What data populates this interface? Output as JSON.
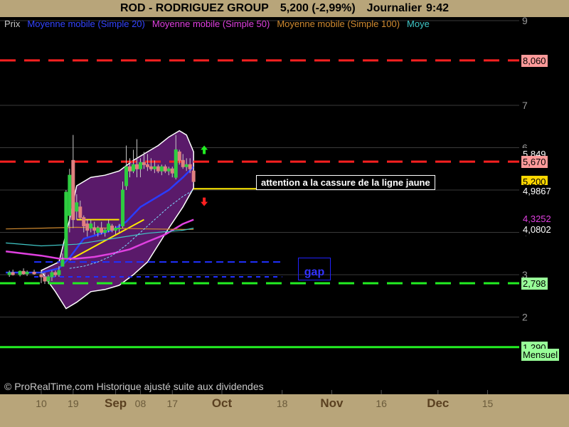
{
  "header": {
    "symbol": "ROD - RODRIGUEZ GROUP",
    "price": "5,200 (-2,99%)",
    "period": "Journalier",
    "time": "9:42"
  },
  "legend": {
    "items": [
      {
        "label": "Prix",
        "color": "#c8c8c8"
      },
      {
        "label": "Moyenne mobile (Simple 20)",
        "color": "#3344ff"
      },
      {
        "label": "Moyenne mobile (Simple 50)",
        "color": "#e040e0"
      },
      {
        "label": "Moyenne mobile (Simple 100)",
        "color": "#d08a30"
      },
      {
        "label": "Moye",
        "color": "#40c8c8"
      }
    ]
  },
  "annotations": {
    "note": "attention a la cassure de la ligne jaune",
    "gap": "gap",
    "copyright": "© ProRealTime.com Historique ajusté suite aux dividendes"
  },
  "price_tags": [
    {
      "value": 8.06,
      "text": "8,060",
      "bg": "#ff9a9a",
      "fg": "#000000"
    },
    {
      "value": 5.849,
      "text": "5,849",
      "bg": "#000000",
      "fg": "#ffffff"
    },
    {
      "value": 5.67,
      "text": "5,670",
      "bg": "#ff9a9a",
      "fg": "#000000"
    },
    {
      "value": 5.2,
      "text": "5,200",
      "bg": "#ffd700",
      "fg": "#000000"
    },
    {
      "value": 4.9867,
      "text": "4,9867",
      "bg": "#000000",
      "fg": "#ffffff"
    },
    {
      "value": 4.3252,
      "text": "4,3252",
      "bg": "#000000",
      "fg": "#e040e0"
    },
    {
      "value": 4.0802,
      "text": "4,0802",
      "bg": "#000000",
      "fg": "#ffffff"
    },
    {
      "value": 2.798,
      "text": "2,798",
      "bg": "#98ff98",
      "fg": "#000000"
    },
    {
      "value": 1.29,
      "text": "1,290",
      "bg": "#98ff98",
      "fg": "#000000"
    },
    {
      "value": 1.12,
      "text": "Mensuel",
      "bg": "#98ff98",
      "fg": "#000000"
    }
  ],
  "chart_data": {
    "type": "candlestick",
    "title": "ROD - RODRIGUEZ GROUP",
    "y_ticks": [
      2,
      3,
      4,
      5,
      6,
      7,
      9
    ],
    "ylim": [
      0.6,
      9.2
    ],
    "x_ticks": [
      {
        "label": "10",
        "bold": false,
        "day": 0
      },
      {
        "label": "19",
        "bold": false,
        "day": 9
      },
      {
        "label": "Sep",
        "bold": true,
        "day": 21
      },
      {
        "label": "08",
        "bold": false,
        "day": 28
      },
      {
        "label": "17",
        "bold": false,
        "day": 37
      },
      {
        "label": "Oct",
        "bold": true,
        "day": 51
      },
      {
        "label": "18",
        "bold": false,
        "day": 68
      },
      {
        "label": "Nov",
        "bold": true,
        "day": 82
      },
      {
        "label": "16",
        "bold": false,
        "day": 96
      },
      {
        "label": "Dec",
        "bold": true,
        "day": 112
      },
      {
        "label": "15",
        "bold": false,
        "day": 126
      }
    ],
    "horizontal_levels": [
      {
        "value": 8.06,
        "color": "#ff2020",
        "dash": "dashed"
      },
      {
        "value": 5.67,
        "color": "#ff2020",
        "dash": "dashed"
      },
      {
        "value": 2.798,
        "color": "#22ee22",
        "dash": "dashed"
      },
      {
        "value": 1.29,
        "color": "#22ee22",
        "dash": "solid"
      }
    ],
    "candles": [
      {
        "day": -9,
        "o": 3.0,
        "h": 3.1,
        "l": 2.95,
        "c": 3.05
      },
      {
        "day": -8,
        "o": 3.05,
        "h": 3.12,
        "l": 2.98,
        "c": 3.0
      },
      {
        "day": -6,
        "o": 3.0,
        "h": 3.1,
        "l": 2.96,
        "c": 3.08
      },
      {
        "day": -5,
        "o": 3.08,
        "h": 3.15,
        "l": 3.0,
        "c": 3.02
      },
      {
        "day": -4,
        "o": 3.02,
        "h": 3.1,
        "l": 2.97,
        "c": 3.06
      },
      {
        "day": -2,
        "o": 3.06,
        "h": 3.12,
        "l": 3.0,
        "c": 3.02
      },
      {
        "day": 0,
        "o": 3.0,
        "h": 3.1,
        "l": 2.8,
        "c": 2.95
      },
      {
        "day": 1,
        "o": 2.95,
        "h": 3.05,
        "l": 2.78,
        "c": 2.85
      },
      {
        "day": 2,
        "o": 2.85,
        "h": 3.0,
        "l": 2.78,
        "c": 2.95
      },
      {
        "day": 3,
        "o": 2.95,
        "h": 3.1,
        "l": 2.85,
        "c": 3.05
      },
      {
        "day": 4,
        "o": 3.05,
        "h": 3.1,
        "l": 2.95,
        "c": 3.0
      },
      {
        "day": 5,
        "o": 3.0,
        "h": 3.2,
        "l": 2.95,
        "c": 3.1
      },
      {
        "day": 6,
        "o": 3.2,
        "h": 3.5,
        "l": 3.2,
        "c": 3.35
      },
      {
        "day": 7,
        "o": 3.4,
        "h": 5.0,
        "l": 3.4,
        "c": 4.95
      },
      {
        "day": 8,
        "o": 4.4,
        "h": 5.5,
        "l": 4.0,
        "c": 5.35
      },
      {
        "day": 9,
        "o": 5.7,
        "h": 6.3,
        "l": 4.1,
        "c": 4.3
      },
      {
        "day": 10,
        "o": 4.5,
        "h": 4.9,
        "l": 4.3,
        "c": 4.7
      },
      {
        "day": 11,
        "o": 4.6,
        "h": 4.75,
        "l": 4.3,
        "c": 4.35
      },
      {
        "day": 12,
        "o": 4.35,
        "h": 4.4,
        "l": 4.0,
        "c": 4.15
      },
      {
        "day": 13,
        "o": 4.2,
        "h": 4.3,
        "l": 3.9,
        "c": 4.05
      },
      {
        "day": 14,
        "o": 4.1,
        "h": 4.3,
        "l": 4.0,
        "c": 4.2
      },
      {
        "day": 15,
        "o": 4.1,
        "h": 4.25,
        "l": 3.95,
        "c": 4.05
      },
      {
        "day": 16,
        "o": 4.0,
        "h": 4.15,
        "l": 3.9,
        "c": 4.1
      },
      {
        "day": 17,
        "o": 4.1,
        "h": 4.25,
        "l": 3.95,
        "c": 4.0
      },
      {
        "day": 18,
        "o": 4.0,
        "h": 4.1,
        "l": 3.9,
        "c": 4.05
      },
      {
        "day": 19,
        "o": 4.05,
        "h": 4.3,
        "l": 4.0,
        "c": 4.2
      },
      {
        "day": 20,
        "o": 4.15,
        "h": 4.2,
        "l": 4.0,
        "c": 4.05
      },
      {
        "day": 21,
        "o": 4.05,
        "h": 4.15,
        "l": 3.95,
        "c": 4.1
      },
      {
        "day": 22,
        "o": 4.1,
        "h": 4.2,
        "l": 4.0,
        "c": 4.1
      },
      {
        "day": 23,
        "o": 4.15,
        "h": 5.2,
        "l": 4.1,
        "c": 5.0
      },
      {
        "day": 24,
        "o": 5.1,
        "h": 6.05,
        "l": 5.0,
        "c": 5.55
      },
      {
        "day": 25,
        "o": 5.55,
        "h": 5.75,
        "l": 5.3,
        "c": 5.45
      },
      {
        "day": 26,
        "o": 5.45,
        "h": 5.95,
        "l": 5.4,
        "c": 5.6
      },
      {
        "day": 27,
        "o": 5.6,
        "h": 6.2,
        "l": 5.3,
        "c": 5.5
      },
      {
        "day": 28,
        "o": 5.5,
        "h": 5.75,
        "l": 5.3,
        "c": 5.65
      },
      {
        "day": 29,
        "o": 5.65,
        "h": 5.9,
        "l": 5.5,
        "c": 5.6
      },
      {
        "day": 30,
        "o": 5.6,
        "h": 5.85,
        "l": 5.45,
        "c": 5.55
      },
      {
        "day": 31,
        "o": 5.55,
        "h": 5.75,
        "l": 5.45,
        "c": 5.5
      },
      {
        "day": 32,
        "o": 5.5,
        "h": 5.7,
        "l": 5.4,
        "c": 5.55
      },
      {
        "day": 33,
        "o": 5.55,
        "h": 5.6,
        "l": 5.4,
        "c": 5.45
      },
      {
        "day": 34,
        "o": 5.45,
        "h": 5.6,
        "l": 5.35,
        "c": 5.55
      },
      {
        "day": 35,
        "o": 5.55,
        "h": 5.6,
        "l": 5.4,
        "c": 5.45
      },
      {
        "day": 36,
        "o": 5.45,
        "h": 5.55,
        "l": 5.35,
        "c": 5.5
      },
      {
        "day": 37,
        "o": 5.5,
        "h": 5.55,
        "l": 5.3,
        "c": 5.4
      },
      {
        "day": 38,
        "o": 5.3,
        "h": 6.3,
        "l": 5.25,
        "c": 5.95
      },
      {
        "day": 39,
        "o": 5.9,
        "h": 5.95,
        "l": 5.6,
        "c": 5.7
      },
      {
        "day": 40,
        "o": 5.7,
        "h": 5.85,
        "l": 5.5,
        "c": 5.55
      },
      {
        "day": 41,
        "o": 5.55,
        "h": 5.75,
        "l": 5.45,
        "c": 5.6
      },
      {
        "day": 42,
        "o": 5.6,
        "h": 5.75,
        "l": 5.4,
        "c": 5.5
      },
      {
        "day": 43,
        "o": 5.45,
        "h": 5.55,
        "l": 5.15,
        "c": 5.2
      }
    ],
    "series": [
      {
        "name": "Moyenne mobile (Simple 20)",
        "color": "#2a3cff",
        "width": 2.5,
        "x": [
          -10,
          0,
          5,
          8,
          12,
          16,
          20,
          24,
          28,
          32,
          36,
          40,
          43
        ],
        "y": [
          3.05,
          3.05,
          3.15,
          3.4,
          3.85,
          3.95,
          4.05,
          4.25,
          4.6,
          4.8,
          5.0,
          5.3,
          5.55
        ]
      },
      {
        "name": "Moyenne mobile (Simple 50)",
        "color": "#e040e0",
        "width": 2.5,
        "x": [
          -10,
          0,
          5,
          10,
          15,
          20,
          25,
          30,
          35,
          40,
          43
        ],
        "y": [
          3.55,
          3.45,
          3.38,
          3.38,
          3.42,
          3.5,
          3.6,
          3.78,
          3.95,
          4.2,
          4.3
        ],
        "dashed_tail_from": 8
      },
      {
        "name": "Moyenne mobile (Simple 100)",
        "color": "#d08a30",
        "width": 1.2,
        "x": [
          -10,
          0,
          10,
          20,
          30,
          40,
          43
        ],
        "y": [
          4.08,
          4.1,
          4.12,
          4.1,
          4.08,
          4.07,
          4.07
        ]
      },
      {
        "name": "Moye",
        "color": "#40c8c8",
        "width": 1.2,
        "x": [
          -10,
          0,
          10,
          20,
          30,
          40,
          43
        ],
        "y": [
          3.75,
          3.68,
          3.72,
          3.85,
          3.98,
          4.05,
          4.1
        ]
      },
      {
        "name": "Moye",
        "color": "#7fd8ff",
        "width": 1,
        "dash": "3,2",
        "x": [
          8,
          12,
          16,
          20,
          24,
          28,
          32,
          36,
          40,
          43
        ],
        "y": [
          3.15,
          3.2,
          3.3,
          3.45,
          3.7,
          4.0,
          4.3,
          4.6,
          4.85,
          5.0
        ]
      }
    ],
    "bollinger": {
      "upper_x": [
        0,
        5,
        8,
        10,
        14,
        18,
        22,
        26,
        30,
        33,
        36,
        39,
        41,
        43
      ],
      "upper_y": [
        3.1,
        3.3,
        4.3,
        5.1,
        5.3,
        5.35,
        5.45,
        5.7,
        5.9,
        6.05,
        6.25,
        6.4,
        6.3,
        5.9
      ],
      "lower_x": [
        43,
        40,
        36,
        33,
        30,
        26,
        22,
        18,
        14,
        10,
        7,
        4,
        1,
        0
      ],
      "lower_y": [
        5.05,
        4.6,
        4.1,
        3.7,
        3.3,
        3.0,
        2.75,
        2.65,
        2.6,
        2.35,
        2.2,
        2.6,
        2.95,
        3.1
      ]
    },
    "trendlines": [
      {
        "color": "#ffea00",
        "x": [
          8,
          29
        ],
        "y": [
          3.35,
          4.3
        ]
      },
      {
        "color": "#ffea00",
        "x": [
          10,
          22
        ],
        "y": [
          4.3,
          4.3
        ]
      },
      {
        "color": "#ffea00",
        "x": [
          43,
          67
        ],
        "y": [
          5.03,
          5.03
        ]
      },
      {
        "color": "#2030ff",
        "x": [
          -2,
          68
        ],
        "y": [
          3.3,
          3.3
        ],
        "dash": "10,6"
      },
      {
        "color": "#2030ff",
        "x": [
          -2,
          68
        ],
        "y": [
          2.95,
          2.95
        ],
        "dash": "6,6"
      }
    ],
    "arrows": [
      {
        "day": 46,
        "value": 5.95,
        "dir": "up",
        "color": "#22ee22"
      },
      {
        "day": 46,
        "value": 4.72,
        "dir": "down",
        "color": "#ff2020"
      }
    ]
  }
}
